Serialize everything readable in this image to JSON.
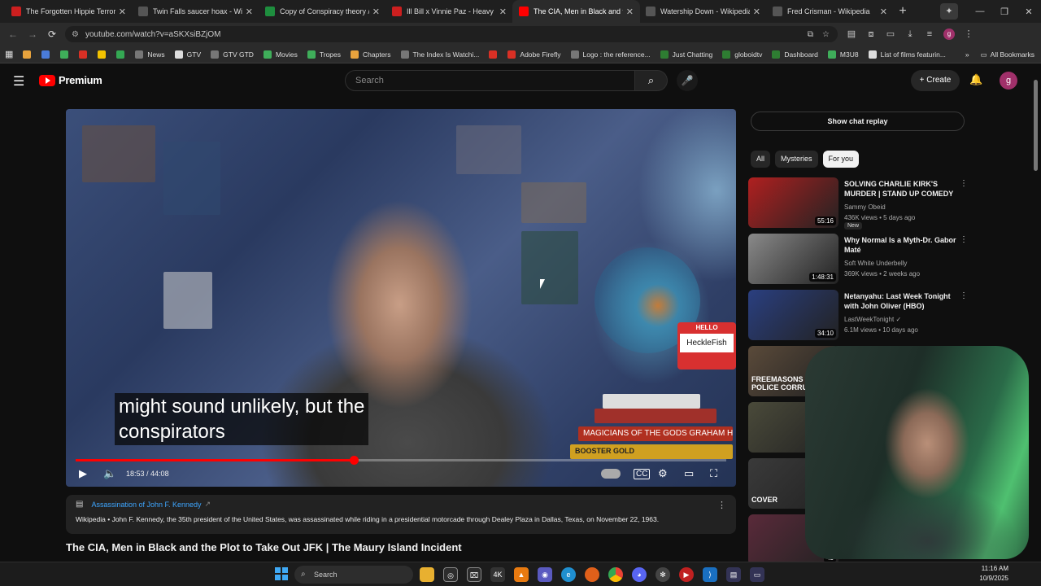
{
  "browser": {
    "tabs": [
      {
        "title": "The Forgotten Hippie Terror Cult",
        "color": "#cc1f1f",
        "active": false
      },
      {
        "title": "Twin Falls saucer hoax - Wikipedia",
        "color": "#555555",
        "active": false
      },
      {
        "title": "Copy of Conspiracy theory / brainstorm",
        "color": "#1e8e3e",
        "active": false
      },
      {
        "title": "Ill Bill x Vinnie Paz - Heavy Metal",
        "color": "#cc1f1f",
        "active": false
      },
      {
        "title": "The CIA, Men in Black and the Plot",
        "color": "#ff0000",
        "active": true
      },
      {
        "title": "Watership Down - Wikipedia",
        "color": "#555555",
        "active": false
      },
      {
        "title": "Fred Crisman - Wikipedia",
        "color": "#555555",
        "active": false
      }
    ],
    "url": "youtube.com/watch?v=aSKXsiBZjOM",
    "bookmarks": [
      {
        "label": "",
        "color": "#e8a33d"
      },
      {
        "label": "",
        "color": "#4a7bd8"
      },
      {
        "label": "",
        "color": "#3fae5a"
      },
      {
        "label": "",
        "color": "#d93025"
      },
      {
        "label": "",
        "color": "#f2c200"
      },
      {
        "label": "",
        "color": "#34a853"
      },
      {
        "label": "News",
        "color": "#777777"
      },
      {
        "label": "GTV",
        "color": "#dddddd"
      },
      {
        "label": "GTV GTD",
        "color": "#777777"
      },
      {
        "label": "Movies",
        "color": "#3fae5a"
      },
      {
        "label": "Tropes",
        "color": "#3fae5a"
      },
      {
        "label": "Chapters",
        "color": "#e8a33d"
      },
      {
        "label": "The Index Is Watchi...",
        "color": "#777777"
      },
      {
        "label": "",
        "color": "#d93025"
      },
      {
        "label": "Adobe Firefly",
        "color": "#d93025"
      },
      {
        "label": "Logo : the reference...",
        "color": "#777777"
      },
      {
        "label": "Just Chatting",
        "color": "#2e7d32"
      },
      {
        "label": "globoidtv",
        "color": "#2e7d32"
      },
      {
        "label": "Dashboard",
        "color": "#2e7d32"
      },
      {
        "label": "M3U8",
        "color": "#3fae5a"
      },
      {
        "label": "List of films featurin...",
        "color": "#dddddd"
      }
    ],
    "all_bookmarks": "All Bookmarks"
  },
  "youtube": {
    "logo_text": "Premium",
    "search_placeholder": "Search",
    "create_label": "Create",
    "avatar_letter": "g"
  },
  "player": {
    "caption_line1": "might sound unlikely, but the",
    "caption_line2": "conspirators",
    "current_time": "18:53",
    "total_time": "44:08",
    "progress_fraction": 0.428,
    "hello_label": "HELLO",
    "hello_name": "HeckleFish",
    "book_titles": [
      "",
      "",
      "MAGICIANS OF THE GODS   GRAHAM HANCOCK",
      "BOOSTER GOLD"
    ]
  },
  "info_panel": {
    "link": "Assassination of John F. Kennedy",
    "source": "Wikipedia",
    "text": "John F. Kennedy, the 35th president of the United States, was assassinated while riding in a presidential motorcade through Dealey Plaza in Dallas, Texas, on November 22, 1963."
  },
  "video_title": "The CIA, Men in Black and the Plot to Take Out JFK | The Maury Island Incident",
  "sidebar": {
    "chat_replay": "Show chat replay",
    "chips": [
      {
        "label": "All",
        "selected": false
      },
      {
        "label": "Mysteries",
        "selected": false
      },
      {
        "label": "For you",
        "selected": true
      }
    ],
    "recommendations": [
      {
        "title": "SOLVING CHARLIE KIRK'S MURDER | STAND UP COMEDY",
        "channel": "Sammy Obeid",
        "meta": "436K views • 5 days ago",
        "duration": "55:16",
        "badge": "New",
        "thumb": "#b02020"
      },
      {
        "title": "Why Normal Is a Myth-Dr. Gabor Maté",
        "channel": "Soft White Underbelly",
        "meta": "369K views • 2 weeks ago",
        "duration": "1:48:31",
        "badge": "",
        "thumb": "#8a8a8a"
      },
      {
        "title": "Netanyahu: Last Week Tonight with John Oliver (HBO)",
        "channel": "LastWeekTonight ✓",
        "meta": "6.1M views • 10 days ago",
        "duration": "34:10",
        "badge": "",
        "thumb": "#2a3f80"
      },
      {
        "title": "",
        "channel": "",
        "meta": "",
        "duration": "",
        "badge": "",
        "thumb": "#5a4a3a",
        "thumb_text": "FREEMASONS & POLICE CORRU"
      },
      {
        "title": "",
        "channel": "",
        "meta": "",
        "duration": "",
        "badge": "",
        "thumb": "#4a4a3a"
      },
      {
        "title": "",
        "channel": "",
        "meta": "",
        "duration": "",
        "badge": "",
        "thumb": "#3a3a3a",
        "thumb_text": "COVER"
      },
      {
        "title": "",
        "channel": "",
        "meta": "",
        "duration": "43",
        "badge": "",
        "thumb": "#5a2a3a"
      }
    ]
  },
  "taskbar": {
    "search": "Search",
    "time": "11:16 AM",
    "date": "10/9/2025"
  }
}
